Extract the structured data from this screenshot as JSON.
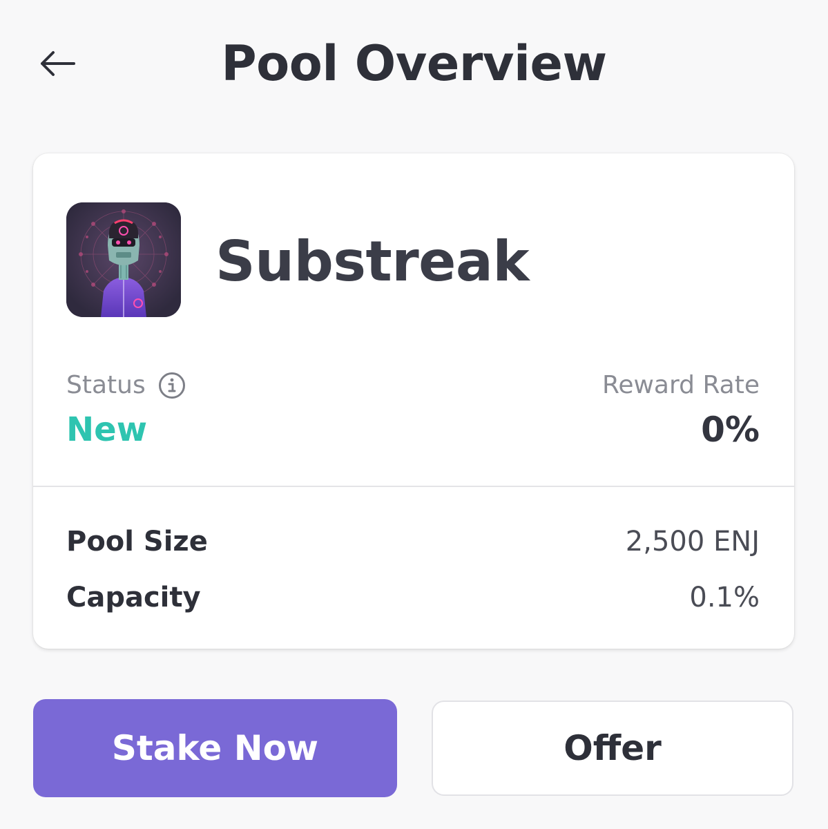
{
  "header": {
    "title": "Pool Overview",
    "back_icon": "arrow-left-icon"
  },
  "pool": {
    "name": "Substreak",
    "avatar_icon": "robot-avatar-icon",
    "status_label": "Status",
    "status_value": "New",
    "status_color": "#2ec4b0",
    "reward_rate_label": "Reward Rate",
    "reward_rate_value": "0%",
    "details": [
      {
        "label": "Pool Size",
        "value": "2,500 ENJ"
      },
      {
        "label": "Capacity",
        "value": "0.1%"
      }
    ]
  },
  "actions": {
    "stake_label": "Stake Now",
    "offer_label": "Offer",
    "accent_color": "#7a69d6"
  }
}
